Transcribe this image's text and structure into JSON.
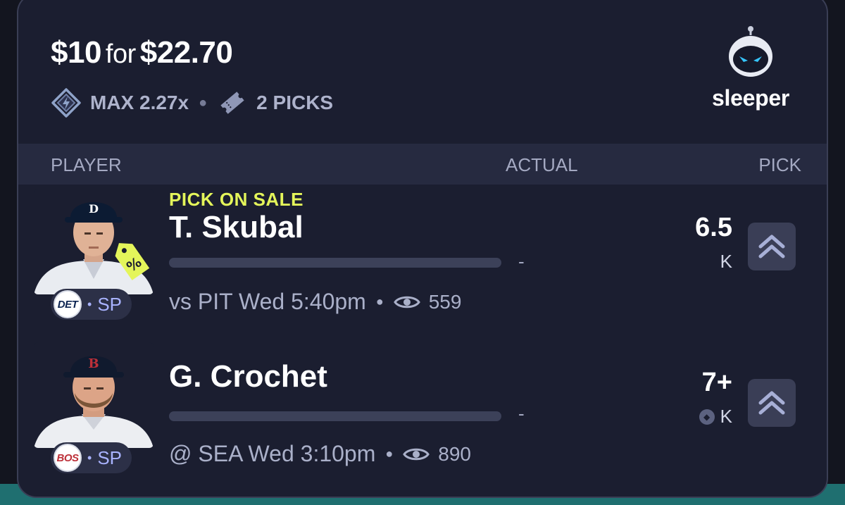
{
  "header": {
    "stake": "$10",
    "for_word": "for",
    "payout": "$22.70",
    "multiplier": "MAX 2.27x",
    "picks": "2 PICKS",
    "brand": "sleeper"
  },
  "columns": {
    "player": "PLAYER",
    "actual": "ACTUAL",
    "pick": "PICK"
  },
  "rows": [
    {
      "promo": "PICK ON SALE",
      "name": "T. Skubal",
      "team": "DET",
      "position": "SP",
      "actual": "-",
      "game": "vs PIT Wed 5:40pm",
      "views": "559",
      "line": "6.5",
      "stat": "K",
      "pick_direction": "more"
    },
    {
      "promo": "",
      "name": "G. Crochet",
      "team": "BOS",
      "position": "SP",
      "actual": "-",
      "game": "@ SEA Wed 3:10pm",
      "views": "890",
      "line": "7+",
      "stat": "K",
      "pick_direction": "more"
    }
  ],
  "colors": {
    "card_bg": "#1b1e30",
    "header_row_bg": "#262a40",
    "promo": "#e4f55a",
    "accent": "#a9b3ff",
    "teal": "#1f6f70"
  }
}
